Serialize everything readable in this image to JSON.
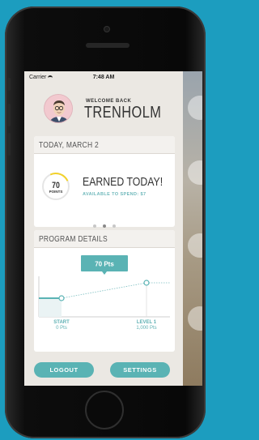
{
  "status_bar": {
    "carrier": "Carrier",
    "time": "7:48 AM"
  },
  "header": {
    "greeting": "WELCOME BACK",
    "name": "TRENHOLM"
  },
  "today_card": {
    "date": "TODAY, MARCH 2",
    "points_value": "70",
    "points_unit": "POINTS",
    "earned_title": "EARNED TODAY!",
    "available_text": "AVAILABLE TO SPEND: $7",
    "page_count": 3,
    "active_page": 1
  },
  "program_card": {
    "title": "PROGRAM DETAILS",
    "tooltip": "70 Pts",
    "start_label": "START",
    "start_value": "0 Pts",
    "level_label": "LEVEL 1",
    "level_value": "1,000 Pts"
  },
  "buttons": {
    "logout": "LOGOUT",
    "settings": "SETTINGS"
  },
  "colors": {
    "accent": "#5ab3b4",
    "background": "#1c9dbf",
    "progress_arc": "#f3d22a"
  }
}
